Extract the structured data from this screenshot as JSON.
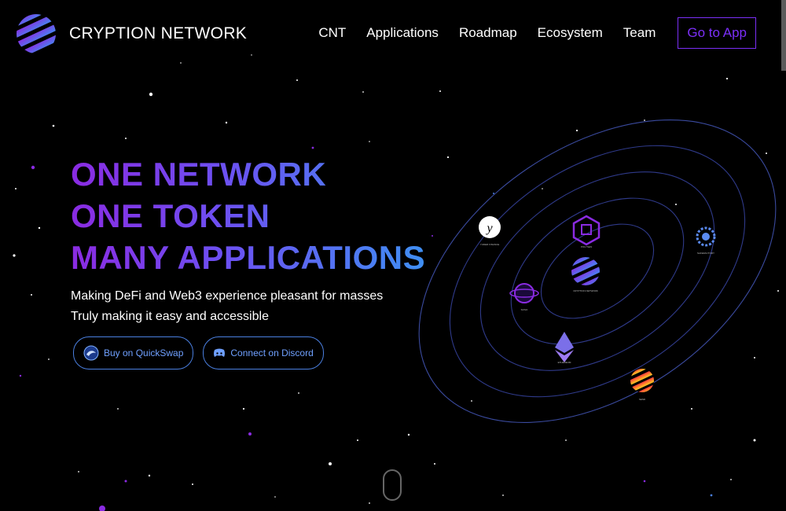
{
  "header": {
    "brand": "CRYPTION NETWORK",
    "nav": [
      "CNT",
      "Applications",
      "Roadmap",
      "Ecosystem",
      "Team"
    ],
    "cta": "Go to App"
  },
  "hero": {
    "headline_1": "ONE NETWORK",
    "headline_2": "ONE TOKEN",
    "headline_3": "MANY APPLICATIONS",
    "subtitle_1": "Making DeFi and Web3 experience pleasant for masses",
    "subtitle_2": "Truly making it easy and accessible"
  },
  "buttons": {
    "quickswap": "Buy on QuickSwap",
    "discord": "Connect on Discord"
  },
  "orbit": {
    "center_label": "CRYPTION NETWORK",
    "planets": [
      "YUDER FINANCE",
      "POLYSEN",
      "SAFEFACTORY",
      "SOSO",
      "ETHEREUM",
      "SEND"
    ]
  },
  "colors": {
    "accent_purple": "#7b2ff7",
    "accent_blue": "#3f8ff3",
    "orbit_ring": "#2f3a8a"
  }
}
